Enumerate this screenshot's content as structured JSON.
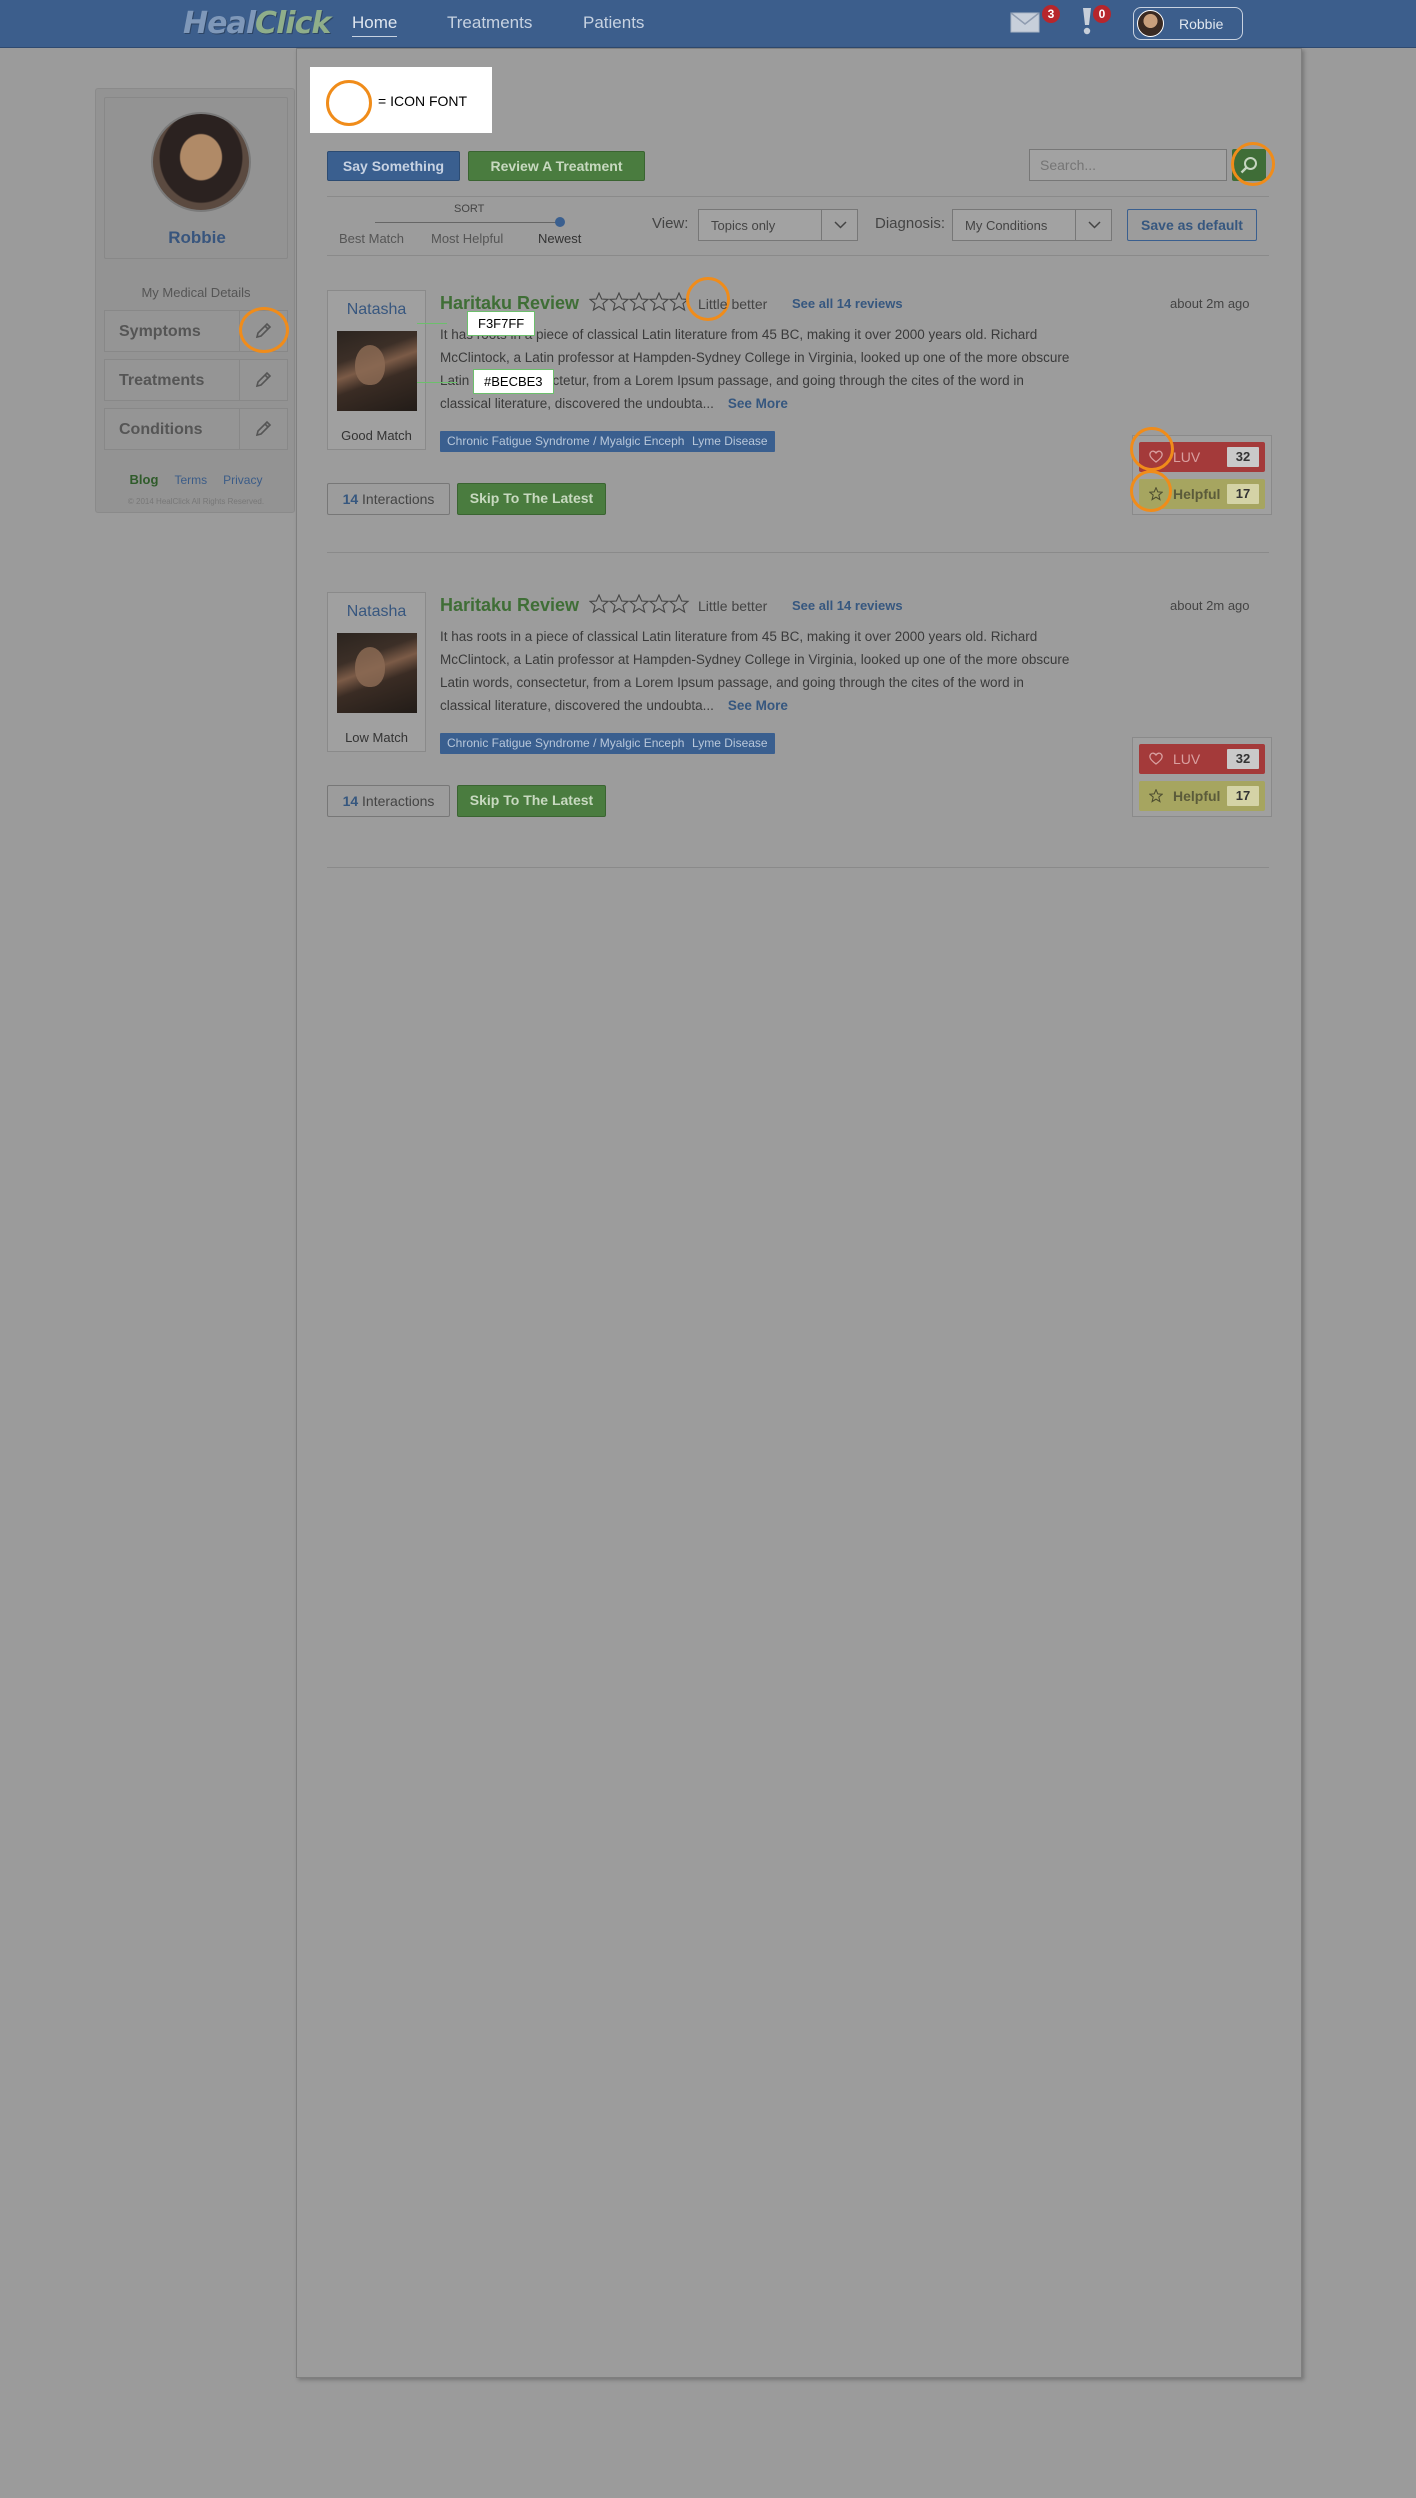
{
  "nav": {
    "logo_part1": "Heal",
    "logo_part2": "Click",
    "links": [
      "Home",
      "Treatments",
      "Patients"
    ],
    "messages_count": "3",
    "alerts_count": "0",
    "user_name": "Robbie"
  },
  "sidebar": {
    "profile_name": "Robbie",
    "medical_title": "My Medical Details",
    "items": [
      "Symptoms",
      "Treatments",
      "Conditions"
    ],
    "footer_links": [
      "Blog",
      "Terms",
      "Privacy"
    ],
    "copyright": "© 2014 HealClick All Rights Reserved."
  },
  "legend": {
    "text": "= ICON FONT"
  },
  "actions": {
    "say_something": "Say Something",
    "review_treatment": "Review A Treatment",
    "search_placeholder": "Search..."
  },
  "filters": {
    "sort_title": "SORT",
    "sort_options": [
      "Best Match",
      "Most Helpful",
      "Newest"
    ],
    "sort_selected": "Newest",
    "view_label": "View:",
    "view_value": "Topics only",
    "diagnosis_label": "Diagnosis:",
    "diagnosis_value": "My Conditions",
    "save_default": "Save as default"
  },
  "annotations": {
    "color1": "F3F7FF",
    "color2": "#BECBE3"
  },
  "posts": [
    {
      "author": "Natasha",
      "match": "Good Match",
      "title": "Haritaku Review",
      "rating_text": "Little better",
      "see_all": "See all 14 reviews",
      "time": "about 2m ago",
      "body": "It has roots in a piece of classical Latin literature from 45 BC, making it over 2000 years old. Richard McClintock, a Latin professor at Hampden-Sydney College in Virginia, looked up one of the more obscure Latin words, consectetur, from a Lorem Ipsum passage, and going through the cites of the word in classical literature, discovered the undoubta...",
      "see_more": "See More",
      "tags": [
        "Chronic Fatigue Syndrome / Myalgic Encephalomyelitis",
        "Lyme Disease"
      ],
      "interactions_count": "14",
      "interactions_label": "Interactions",
      "skip": "Skip To The Latest",
      "luv_label": "LUV",
      "luv_count": "32",
      "helpful_label": "Helpful",
      "helpful_count": "17"
    },
    {
      "author": "Natasha",
      "match": "Low Match",
      "title": "Haritaku Review",
      "rating_text": "Little better",
      "see_all": "See all 14 reviews",
      "time": "about 2m ago",
      "body": "It has roots in a piece of classical Latin literature from 45 BC, making it over 2000 years old. Richard McClintock, a Latin professor at Hampden-Sydney College in Virginia, looked up one of the more obscure Latin words, consectetur, from a Lorem Ipsum passage, and going through the cites of the word in classical literature, discovered the undoubta...",
      "see_more": "See More",
      "tags": [
        "Chronic Fatigue Syndrome / Myalgic Encephalomyelitis",
        "Lyme Disease"
      ],
      "interactions_count": "14",
      "interactions_label": "Interactions",
      "skip": "Skip To The Latest",
      "luv_label": "LUV",
      "luv_count": "32",
      "helpful_label": "Helpful",
      "helpful_count": "17"
    }
  ]
}
